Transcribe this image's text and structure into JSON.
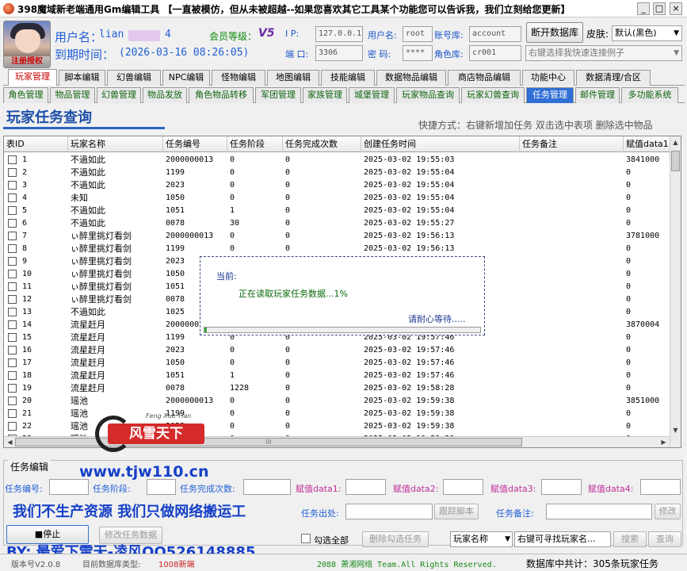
{
  "window": {
    "title": "398魔域新老端通用Gm编辑工具 【一直被模仿，但从未被超越--如果您喜欢其它工具某个功能您可以告诉我，我们立刻给您更新】",
    "minimize": "_",
    "maximize": "□",
    "close": "×"
  },
  "user": {
    "name_label": "用户名：",
    "name_value": "lian",
    "name_suffix": "4",
    "expire_label": "到期时间：",
    "expire_value": "(2026-03-16 08:26:05)",
    "level_label": "会员等级：",
    "level_value": "V5",
    "avatar_mark": "注册授权"
  },
  "conn": {
    "ip_label": "I  P:",
    "ip_value": "127.0.0.1",
    "port_label": "端 口:",
    "port_value": "3306",
    "user_label": "用户名:",
    "user_value": "root",
    "pwd_label": "密  码:",
    "pwd_value": "****",
    "acctdb_label": "账号库:",
    "acctdb_value": "account",
    "roledb_label": "角色库:",
    "roledb_value": "cr001",
    "disconnect": "断开数据库",
    "skin_label": "皮肤:",
    "skin_value": "默认(黑色)",
    "quickconnect_placeholder": "右键选择我快速连接例子"
  },
  "tabs1": [
    "玩家管理",
    "脚本编辑",
    "幻兽编辑",
    "NPC编辑",
    "怪物编辑",
    "地图编辑",
    "技能编辑",
    "数据物品编辑",
    "商店物品编辑",
    "功能中心",
    "数据清理/合区"
  ],
  "tabs2": [
    "角色管理",
    "物品管理",
    "幻兽管理",
    "物品发放",
    "角色物品转移",
    "军团管理",
    "家族管理",
    "城堡管理",
    "玩家物品查询",
    "玩家幻兽查询",
    "任务管理",
    "邮件管理",
    "多功能系统"
  ],
  "page": {
    "title": "玩家任务查询",
    "shortcuts": "快捷方式：右键新增加任务 双击选中表项 删除选中物品"
  },
  "table": {
    "headers": [
      "表ID",
      "玩家名称",
      "任务编号",
      "任务阶段",
      "任务完成次数",
      "创建任务时间",
      "任务备注",
      "赋值data1"
    ],
    "rows": [
      [
        "1",
        "不過如此",
        "2000000013",
        "0",
        "0",
        "2025-03-02 19:55:03",
        "",
        "3841000"
      ],
      [
        "2",
        "不過如此",
        "1199",
        "0",
        "0",
        "2025-03-02 19:55:04",
        "",
        "0"
      ],
      [
        "3",
        "不過如此",
        "2023",
        "0",
        "0",
        "2025-03-02 19:55:04",
        "",
        "0"
      ],
      [
        "4",
        "未知",
        "1050",
        "0",
        "0",
        "2025-03-02 19:55:04",
        "",
        "0"
      ],
      [
        "5",
        "不過如此",
        "1051",
        "1",
        "0",
        "2025-03-02 19:55:04",
        "",
        "0"
      ],
      [
        "6",
        "不過如此",
        "0078",
        "30",
        "0",
        "2025-03-02 19:55:27",
        "",
        "0"
      ],
      [
        "7",
        "ぃ醉里挑灯看剑",
        "2000000013",
        "0",
        "0",
        "2025-03-02 19:56:13",
        "",
        "3781000"
      ],
      [
        "8",
        "ぃ醉里挑灯看剑",
        "1199",
        "0",
        "0",
        "2025-03-02 19:56:13",
        "",
        "0"
      ],
      [
        "9",
        "ぃ醉里挑灯看剑",
        "2023",
        "",
        "",
        "",
        "",
        "0"
      ],
      [
        "10",
        "ぃ醉里挑灯看剑",
        "1050",
        "",
        "",
        "",
        "",
        "0"
      ],
      [
        "11",
        "ぃ醉里挑灯看剑",
        "1051",
        "",
        "",
        "",
        "",
        "0"
      ],
      [
        "12",
        "ぃ醉里挑灯看剑",
        "0078",
        "",
        "",
        "",
        "",
        "0"
      ],
      [
        "13",
        "不過如此",
        "1025",
        "",
        "",
        "",
        "",
        "0"
      ],
      [
        "14",
        "流星赶月",
        "2000000",
        "",
        "",
        "",
        "",
        "3870004"
      ],
      [
        "15",
        "流星赶月",
        "1199",
        "0",
        "0",
        "2025-03-02 19:57:46",
        "",
        "0"
      ],
      [
        "16",
        "流星赶月",
        "2023",
        "0",
        "0",
        "2025-03-02 19:57:46",
        "",
        "0"
      ],
      [
        "17",
        "流星赶月",
        "1050",
        "0",
        "0",
        "2025-03-02 19:57:46",
        "",
        "0"
      ],
      [
        "18",
        "流星赶月",
        "1051",
        "1",
        "0",
        "2025-03-02 19:57:46",
        "",
        "0"
      ],
      [
        "19",
        "流星赶月",
        "0078",
        "1228",
        "0",
        "2025-03-02 19:58:28",
        "",
        "0"
      ],
      [
        "20",
        "瑶池",
        "2000000013",
        "0",
        "0",
        "2025-03-02 19:59:38",
        "",
        "3851000"
      ],
      [
        "21",
        "瑶池",
        "1199",
        "0",
        "0",
        "2025-03-02 19:59:38",
        "",
        "0"
      ],
      [
        "22",
        "瑶池",
        "2023",
        "0",
        "0",
        "2025-03-02 19:59:38",
        "",
        "0"
      ],
      [
        "23",
        "瑶池",
        "1050",
        "0",
        "0",
        "2025-03-02 19:59:38",
        "",
        "0"
      ]
    ],
    "hscroll_grip": "III"
  },
  "dialog": {
    "label": "当前:",
    "message": "正在读取玩家任务数据...1%",
    "wait": "请耐心等待....."
  },
  "watermark": {
    "script": "Feng Xue Tian",
    "text": "风雪天下"
  },
  "edit": {
    "group_label": "任务编辑",
    "task_id": "任务编号:",
    "task_stage": "任务阶段:",
    "task_done": "任务完成次数:",
    "data1": "赋值data1:",
    "data2": "赋值data2:",
    "data3": "赋值data3:",
    "data4": "赋值data4:",
    "source": "任务出处:",
    "follow_script": "跟踪脚本",
    "remark": "任务备注:",
    "modify": "修改",
    "stop": "■停止",
    "modify_task": "修改任务数据",
    "select_all": "勾选全部",
    "delete_checked": "删除勾选任务",
    "search_field": "玩家名称",
    "search_placeholder": "右键可寻找玩家名...",
    "search": "搜索",
    "query": "查询"
  },
  "promo": {
    "url": "www.tjw110.cn",
    "slogan": "我们不生产资源 我们只做网络搬运工",
    "byline": "BY: 最爱下雪天-凌风QQ526148885"
  },
  "status": {
    "version": "版本号V2.0.8",
    "db_type": "目前数据库类型:",
    "db_val": "1008新端",
    "copyright": "2088 萧湘网络 Team.All Rights Reserved.",
    "total": "数据库中共计：305条玩家任务"
  }
}
